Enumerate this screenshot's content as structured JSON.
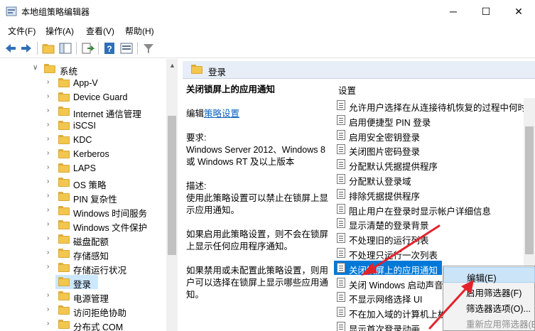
{
  "window": {
    "title": "本地组策略编辑器",
    "controls": {
      "minimize": "─",
      "maximize": "☐",
      "close": "✕"
    }
  },
  "menubar": {
    "items": [
      "文件(F)",
      "操作(A)",
      "查看(V)",
      "帮助(H)"
    ]
  },
  "toolbar": {
    "icons": [
      "back-icon",
      "forward-icon",
      "up-folder-icon",
      "show-hide-tree-icon",
      "export-list-icon",
      "help-icon",
      "properties-icon",
      "filter-icon"
    ]
  },
  "tree": {
    "parent": {
      "label": "系统",
      "expanded": true
    },
    "children": [
      {
        "label": "App-V",
        "selected": false
      },
      {
        "label": "Device Guard",
        "selected": false
      },
      {
        "label": "Internet 通信管理",
        "selected": false
      },
      {
        "label": "iSCSI",
        "selected": false
      },
      {
        "label": "KDC",
        "selected": false
      },
      {
        "label": "Kerberos",
        "selected": false
      },
      {
        "label": "LAPS",
        "selected": false
      },
      {
        "label": "OS 策略",
        "selected": false
      },
      {
        "label": "PIN 复杂性",
        "selected": false
      },
      {
        "label": "Windows 时间服务",
        "selected": false
      },
      {
        "label": "Windows 文件保护",
        "selected": false
      },
      {
        "label": "磁盘配额",
        "selected": false
      },
      {
        "label": "存储感知",
        "selected": false
      },
      {
        "label": "存储运行状况",
        "selected": false
      },
      {
        "label": "登录",
        "selected": true
      },
      {
        "label": "电源管理",
        "selected": false
      },
      {
        "label": "访问拒绝协助",
        "selected": false
      },
      {
        "label": "分布式 COM",
        "selected": false
      }
    ]
  },
  "right_pane": {
    "header": "登录",
    "description": {
      "policy_title": "关闭锁屏上的应用通知",
      "edit_prefix": "编辑",
      "edit_link": "策略设置",
      "requirements_label": "要求:",
      "requirements_text": "Windows Server 2012、Windows 8 或 Windows RT 及以上版本",
      "description_label": "描述:",
      "description_text": "使用此策略设置可以禁止在锁屏上显示应用通知。",
      "enabled_text": "如果启用此策略设置，则不会在锁屏上显示任何应用程序通知。",
      "disabled_text": "如果禁用或未配置此策略设置，则用户可以选择在锁屏上显示哪些应用通知。"
    },
    "settings_column": "设置",
    "settings": [
      {
        "label": "允许用户选择在从连接待机恢复的过程中何时",
        "selected": false
      },
      {
        "label": "启用便捷型 PIN 登录",
        "selected": false
      },
      {
        "label": "启用安全密钥登录",
        "selected": false
      },
      {
        "label": "关闭图片密码登录",
        "selected": false
      },
      {
        "label": "分配默认凭据提供程序",
        "selected": false
      },
      {
        "label": "分配默认登录域",
        "selected": false
      },
      {
        "label": "排除凭据提供程序",
        "selected": false
      },
      {
        "label": "阻止用户在登录时显示帐户详细信息",
        "selected": false
      },
      {
        "label": "显示清楚的登录背景",
        "selected": false
      },
      {
        "label": "不处理旧的运行列表",
        "selected": false
      },
      {
        "label": "不处理只运行一次列表",
        "selected": false
      },
      {
        "label": "关闭锁屏上的应用通知",
        "selected": true
      },
      {
        "label": "关闭 Windows 启动声音",
        "selected": false
      },
      {
        "label": "不显示网络选择 UI",
        "selected": false
      },
      {
        "label": "不在加入域的计算机上枚",
        "selected": false
      },
      {
        "label": "显示首次登录动画",
        "selected": false
      }
    ]
  },
  "context_menu": {
    "items": [
      {
        "label": "编辑(E)",
        "hover": true,
        "disabled": false
      },
      {
        "label": "启用筛选器(F)",
        "hover": false,
        "disabled": false
      },
      {
        "label": "筛选器选项(O)...",
        "hover": false,
        "disabled": false
      },
      {
        "label": "重新应用筛选器(E",
        "hover": false,
        "disabled": true
      }
    ]
  },
  "colors": {
    "selection": "#0078d7",
    "tree_selection": "#cce8ff",
    "folder": "#f3c64d",
    "link": "#0b64c0",
    "annotation_arrow": "#e3232c"
  }
}
